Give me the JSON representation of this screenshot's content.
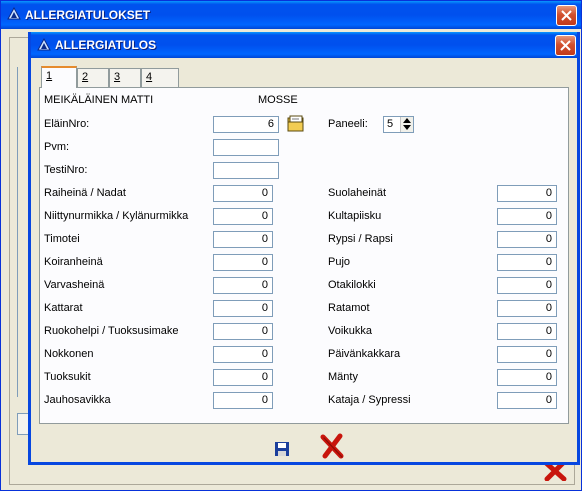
{
  "bg_window": {
    "title": "ALLERGIATULOKSET"
  },
  "dialog": {
    "title": "ALLERGIATULOS",
    "tabs": [
      {
        "label": "1"
      },
      {
        "label": "2"
      },
      {
        "label": "3"
      },
      {
        "label": "4"
      }
    ],
    "owner_name": "MEIKÄLÄINEN MATTI",
    "animal_name": "MOSSE",
    "elain_nro_label": "EläinNro:",
    "elain_nro_value": "6",
    "paneeli_label": "Paneeli:",
    "paneeli_value": "5",
    "pvm_label": "Pvm:",
    "pvm_value": "",
    "testinro_label": "TestiNro:",
    "testinro_value": "",
    "left_allergens": [
      {
        "label": "Raiheinä / Nadat",
        "value": "0"
      },
      {
        "label": "Niittynurmikka / Kylänurmikka",
        "value": "0"
      },
      {
        "label": "Timotei",
        "value": "0"
      },
      {
        "label": "Koiranheinä",
        "value": "0"
      },
      {
        "label": "Varvasheinä",
        "value": "0"
      },
      {
        "label": "Kattarat",
        "value": "0"
      },
      {
        "label": "Ruokohelpi / Tuoksusimake",
        "value": "0"
      },
      {
        "label": "Nokkonen",
        "value": "0"
      },
      {
        "label": "Tuoksukit",
        "value": "0"
      },
      {
        "label": "Jauhosavikka",
        "value": "0"
      }
    ],
    "right_allergens": [
      {
        "label": "Suolaheinät",
        "value": "0"
      },
      {
        "label": "Kultapiisku",
        "value": "0"
      },
      {
        "label": "Rypsi / Rapsi",
        "value": "0"
      },
      {
        "label": "Pujo",
        "value": "0"
      },
      {
        "label": "Otakilokki",
        "value": "0"
      },
      {
        "label": "Ratamot",
        "value": "0"
      },
      {
        "label": "Voikukka",
        "value": "0"
      },
      {
        "label": "Päivänkakkara",
        "value": "0"
      },
      {
        "label": "Mänty",
        "value": "0"
      },
      {
        "label": "Kataja / Sypressi",
        "value": "0"
      }
    ],
    "icons": {
      "save": "save-disk-icon",
      "cancel": "red-x-icon",
      "folder": "folder-icon",
      "close": "close-icon"
    }
  },
  "colors": {
    "titlebar": "#0053ee",
    "close": "#d2502f",
    "cancel_x": "#c8150c",
    "save_disk": "#1b3f9c"
  }
}
